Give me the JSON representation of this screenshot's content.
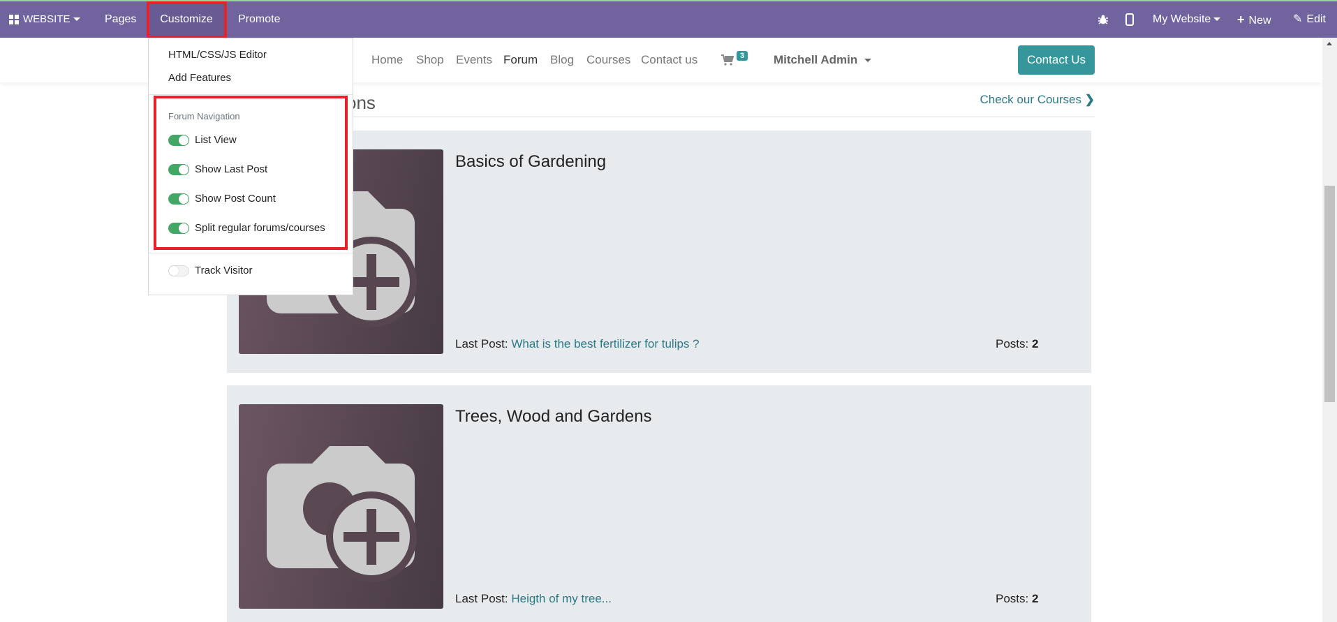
{
  "navbar": {
    "app": "WEBSITE",
    "pages": "Pages",
    "customize": "Customize",
    "promote": "Promote",
    "site": "My Website",
    "new": "New",
    "edit": "Edit"
  },
  "site_nav": {
    "links": [
      "Home",
      "Shop",
      "Events",
      "Forum",
      "Blog",
      "Courses",
      "Contact us"
    ],
    "active": "Forum",
    "cart_count": "3",
    "user": "Mitchell Admin",
    "contact_button": "Contact Us"
  },
  "section": {
    "title_visible": "ons",
    "check_courses": "Check our Courses"
  },
  "forums": [
    {
      "title": "Basics of Gardening",
      "last_post_label": "Last Post:",
      "last_post": "What is the best fertilizer for tulips ?",
      "posts_label": "Posts:",
      "posts": "2"
    },
    {
      "title": "Trees, Wood and Gardens",
      "last_post_label": "Last Post:",
      "last_post": "Heigth of my tree...",
      "posts_label": "Posts:",
      "posts": "2"
    }
  ],
  "customize_menu": {
    "items": [
      "HTML/CSS/JS Editor",
      "Add Features"
    ],
    "group_header": "Forum Navigation",
    "toggles": [
      {
        "label": "List View",
        "on": true
      },
      {
        "label": "Show Last Post",
        "on": true
      },
      {
        "label": "Show Post Count",
        "on": true
      },
      {
        "label": "Split regular forums/courses",
        "on": true
      }
    ],
    "track_visitor": {
      "label": "Track Visitor",
      "on": false
    }
  },
  "colors": {
    "navbar": "#71639e",
    "accent": "#35979c",
    "toggle_on": "#43a865",
    "highlight": "#e8202a"
  }
}
